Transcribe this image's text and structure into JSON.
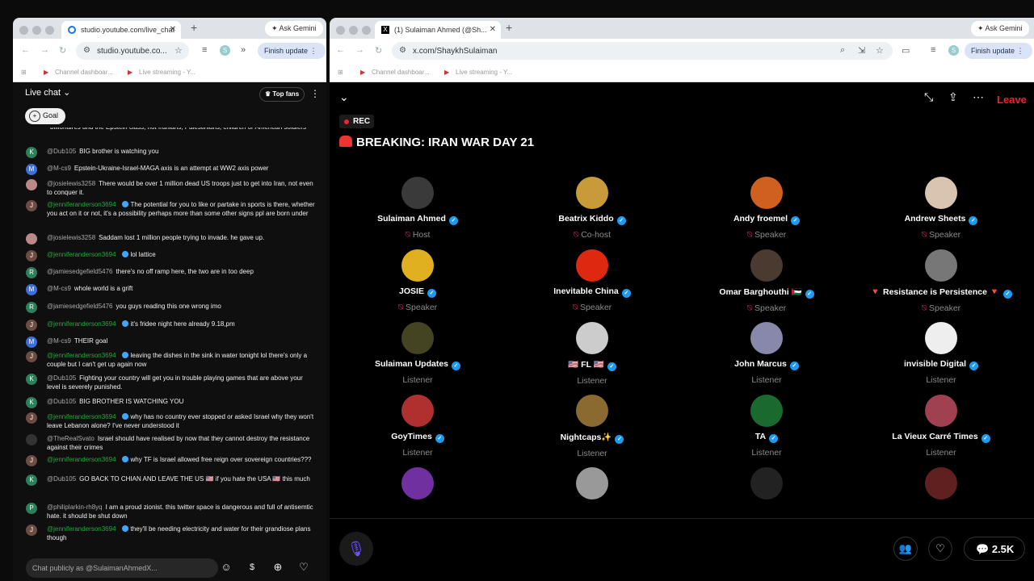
{
  "left_window": {
    "tab_title": "studio.youtube.com/live_chat",
    "ask_gemini": "Ask Gemini",
    "url": "studio.youtube.co...",
    "finish_update": "Finish update",
    "profile_letter": "S",
    "bookmarks": [
      "Channel dashboar...",
      "Live streaming - Y..."
    ],
    "chat_header": "Live chat",
    "top_fans": "Top fans",
    "goal": "Goal",
    "input_placeholder": "Chat publicly as @SulaimanAhmedX...",
    "messages": [
      {
        "avatar": "",
        "avatar_color": "#0f0f0f",
        "user": "",
        "member": false,
        "verified": false,
        "text": "billionaires and the Epstein class, not Iranians, Palestinians, children or American soldiers"
      },
      {
        "avatar": "K",
        "avatar_color": "#2e7d5b",
        "user": "@Dub105",
        "member": false,
        "verified": false,
        "text": "BIG brother is watching you"
      },
      {
        "avatar": "M",
        "avatar_color": "#3e6fd8",
        "user": "@M-cs9",
        "member": false,
        "verified": false,
        "text": "Epstein-Ukraine-Israel-MAGA axis is an attempt at WW2 axis power"
      },
      {
        "avatar": "",
        "avatar_color": "#b88",
        "user": "@josielewis3258",
        "member": false,
        "verified": false,
        "text": "There would be over 1 million dead US troops just to get into Iran, not even to conquer it."
      },
      {
        "avatar": "J",
        "avatar_color": "#6d4c41",
        "user": "@jenniferanderson3694",
        "member": true,
        "verified": true,
        "text": "The potential for you to like or partake in sports is there, whether you act on it or not, it's a possibility perhaps more than some other signs ppl are born under"
      },
      {
        "avatar": "",
        "avatar_color": "#b88",
        "user": "@josielewis3258",
        "member": false,
        "verified": false,
        "text": "Saddam lost 1 million people trying to invade. he gave up."
      },
      {
        "avatar": "J",
        "avatar_color": "#6d4c41",
        "user": "@jenniferanderson3694",
        "member": true,
        "verified": true,
        "text": "lol lattice"
      },
      {
        "avatar": "R",
        "avatar_color": "#2e7d5b",
        "user": "@jamiesedgefield5476",
        "member": false,
        "verified": false,
        "text": "there's no off ramp here, the two are in too deep"
      },
      {
        "avatar": "M",
        "avatar_color": "#3e6fd8",
        "user": "@M-cs9",
        "member": false,
        "verified": false,
        "text": "whole world is a grift"
      },
      {
        "avatar": "R",
        "avatar_color": "#2e7d5b",
        "user": "@jamiesedgefield5476",
        "member": false,
        "verified": false,
        "text": "you guys reading this one wrong imo"
      },
      {
        "avatar": "J",
        "avatar_color": "#6d4c41",
        "user": "@jenniferanderson3694",
        "member": true,
        "verified": true,
        "text": "it's fridee night here already 9.18,pm"
      },
      {
        "avatar": "M",
        "avatar_color": "#3e6fd8",
        "user": "@M-cs9",
        "member": false,
        "verified": false,
        "text": "THEIR goal"
      },
      {
        "avatar": "J",
        "avatar_color": "#6d4c41",
        "user": "@jenniferanderson3694",
        "member": true,
        "verified": true,
        "text": "leaving the dishes in the sink in water tonight lol there's only a couple but I can't get up again now"
      },
      {
        "avatar": "K",
        "avatar_color": "#2e7d5b",
        "user": "@Dub105",
        "member": false,
        "verified": false,
        "text": "Fighting your country will get you in trouble playing games that are above your level is severely punished."
      },
      {
        "avatar": "K",
        "avatar_color": "#2e7d5b",
        "user": "@Dub105",
        "member": false,
        "verified": false,
        "text": "BIG BROTHER IS WATCHING YOU"
      },
      {
        "avatar": "J",
        "avatar_color": "#6d4c41",
        "user": "@jenniferanderson3694",
        "member": true,
        "verified": true,
        "text": "why has no country ever stopped or asked Israel why they won't leave Lebanon alone? I've never understood it"
      },
      {
        "avatar": "",
        "avatar_color": "#333",
        "user": "@TheRealSvato",
        "member": false,
        "verified": false,
        "text": "Israel should have realised by now that they cannot destroy the resistance against their crimes"
      },
      {
        "avatar": "J",
        "avatar_color": "#6d4c41",
        "user": "@jenniferanderson3694",
        "member": true,
        "verified": true,
        "text": "why TF is Israel allowed free reign over sovereign countries???"
      },
      {
        "avatar": "K",
        "avatar_color": "#2e7d5b",
        "user": "@Dub105",
        "member": false,
        "verified": false,
        "text": "GO BACK TO CHIAN AND LEAVE THE US 🇺🇸 if you hate the USA 🇺🇸 this much"
      },
      {
        "avatar": "P",
        "avatar_color": "#2e7d5b",
        "user": "@philiplarkin-rh8yq",
        "member": false,
        "verified": false,
        "text": "I am a proud zionist. this twitter space is dangerous and full of antisemtic hate. it should be shut down"
      },
      {
        "avatar": "J",
        "avatar_color": "#6d4c41",
        "user": "@jenniferanderson3694",
        "member": true,
        "verified": true,
        "text": "they'll be needing electricity and water for their grandiose plans though"
      }
    ]
  },
  "right_window": {
    "tab_title": "(1) Sulaiman Ahmed (@Sh...",
    "ask_gemini": "Ask Gemini",
    "url": "x.com/ShaykhSulaiman",
    "finish_update": "Finish update",
    "profile_letter": "S",
    "bookmarks": [
      "Channel dashboar...",
      "Live streaming - Y..."
    ],
    "leave": "Leave",
    "rec": "REC",
    "title": "BREAKING: IRAN WAR DAY 21",
    "listener_count": "2.5K",
    "participants": [
      {
        "name": "Sulaiman Ahmed",
        "role": "Host",
        "color": "#3a3a3a"
      },
      {
        "name": "Beatrix Kiddo",
        "role": "Co-host",
        "color": "#c99a3a"
      },
      {
        "name": "Andy froemel",
        "role": "Speaker",
        "color": "#d06020"
      },
      {
        "name": "Andrew Sheets",
        "role": "Speaker",
        "color": "#d8c4b0"
      },
      {
        "name": "JOSIE",
        "role": "Speaker",
        "color": "#e0b020"
      },
      {
        "name": "Inevitable China",
        "role": "Speaker",
        "color": "#de2910"
      },
      {
        "name": "Omar Barghouthi 🇵🇸",
        "role": "Speaker",
        "color": "#4a3a30"
      },
      {
        "name": "🔻 Resistance is Persistence 🔻",
        "role": "Speaker",
        "color": "#777"
      },
      {
        "name": "Sulaiman Updates",
        "role": "Listener",
        "color": "#442"
      },
      {
        "name": "🇺🇸 FL 🇺🇸",
        "role": "Listener",
        "color": "#ccc"
      },
      {
        "name": "John Marcus",
        "role": "Listener",
        "color": "#88a"
      },
      {
        "name": "invisible Digital",
        "role": "Listener",
        "color": "#eee"
      },
      {
        "name": "GoyTimes",
        "role": "Listener",
        "color": "#b03030"
      },
      {
        "name": "Nightcaps✨",
        "role": "Listener",
        "color": "#8a6a30"
      },
      {
        "name": "TA",
        "role": "Listener",
        "color": "#1a6a30"
      },
      {
        "name": "La Vieux Carré Times",
        "role": "Listener",
        "color": "#a04050"
      },
      {
        "name": "",
        "role": "",
        "color": "#7030a0"
      },
      {
        "name": "",
        "role": "",
        "color": "#999"
      },
      {
        "name": "",
        "role": "",
        "color": "#222"
      },
      {
        "name": "",
        "role": "",
        "color": "#602020"
      }
    ]
  }
}
